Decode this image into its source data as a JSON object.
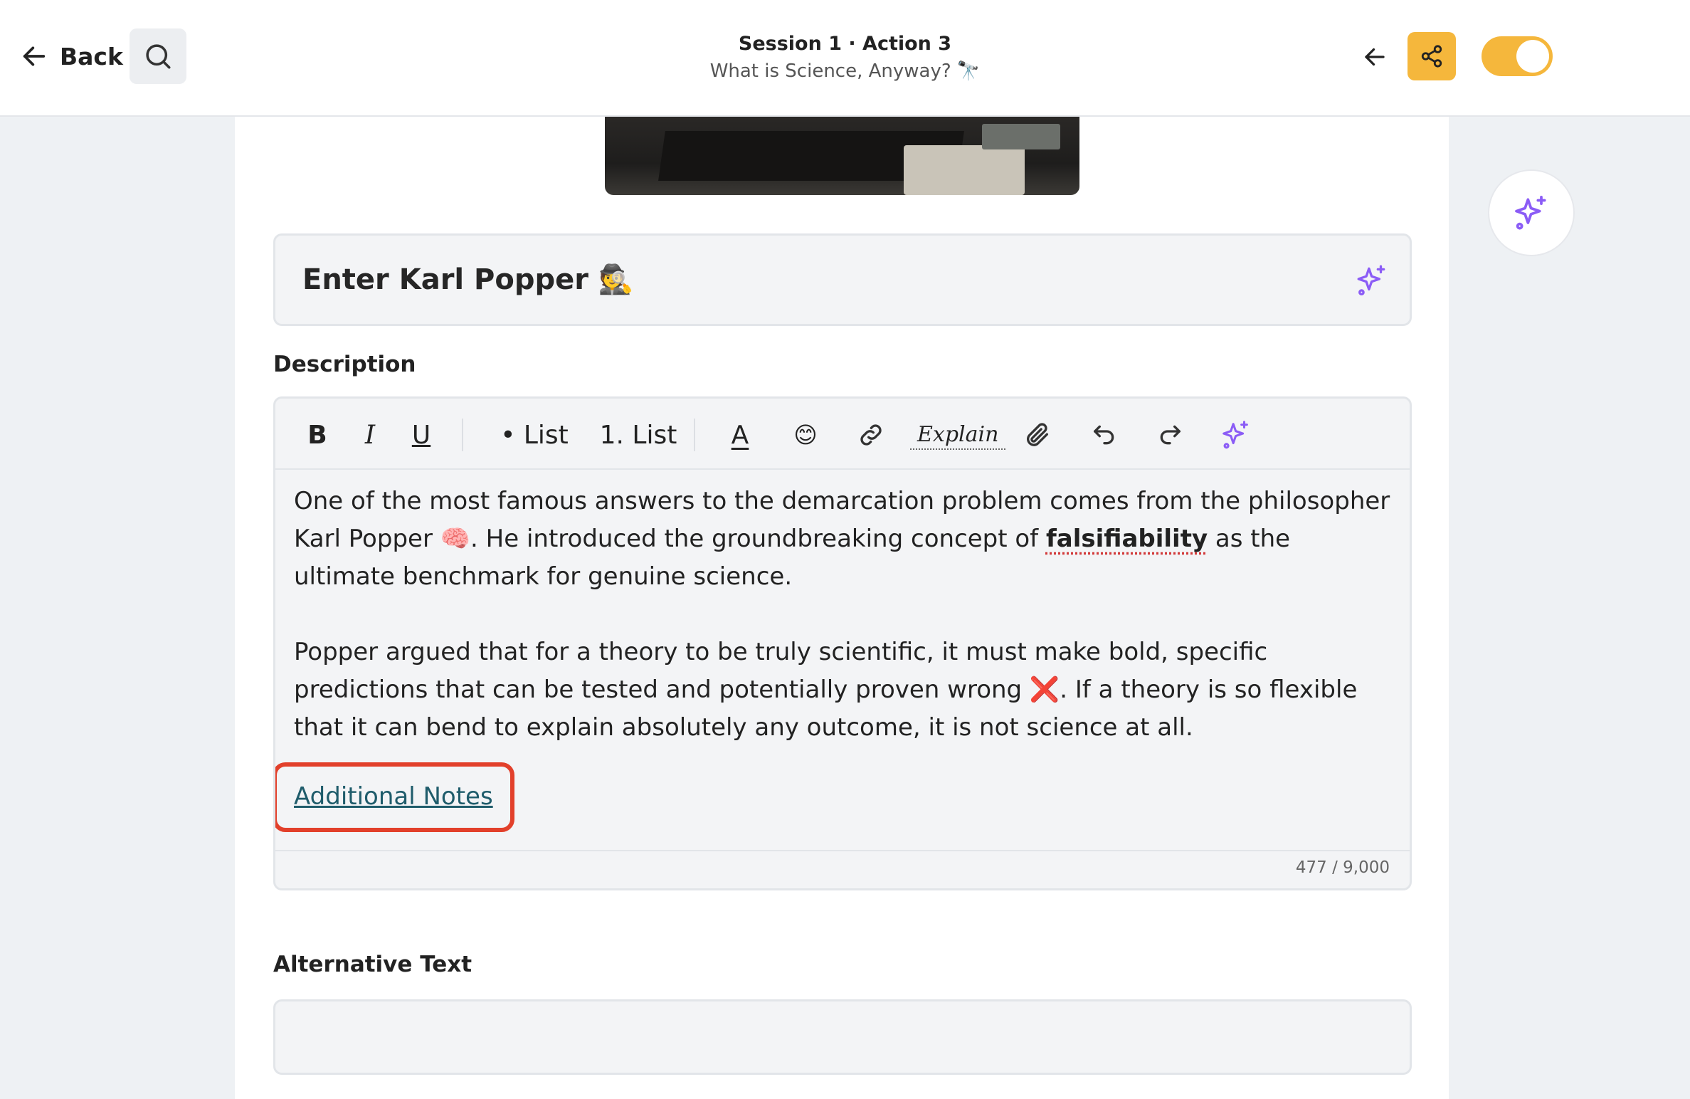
{
  "header": {
    "back_label": "Back",
    "title": "Session 1 · Action 3",
    "subtitle": "What is Science, Anyway? 🔭",
    "toggle_on": true
  },
  "title_field": {
    "value": "Enter Karl Popper 🕵️"
  },
  "description": {
    "label": "Description",
    "toolbar": {
      "bold": "B",
      "italic": "I",
      "underline": "U",
      "bullet_list": "• List",
      "numbered_list": "1. List",
      "text_color": "A",
      "emoji": "😊",
      "explain": "Explain"
    },
    "paragraph1_pre": "One of the most famous answers to the demarcation problem comes from the philosopher Karl Popper 🧠. He introduced the groundbreaking concept of ",
    "paragraph1_bold": "falsifiability",
    "paragraph1_post": " as the ultimate benchmark for genuine science.",
    "paragraph2": "Popper argued that for a theory to be truly scientific, it must make bold, specific predictions that can be tested and potentially proven wrong ❌. If a theory is so flexible that it can bend to explain absolutely any outcome, it is not science at all.",
    "link_text": "Additional Notes",
    "char_count": "477 / 9,000"
  },
  "alt_text": {
    "label": "Alternative Text",
    "value": ""
  },
  "colors": {
    "accent": "#f5b73c",
    "ai_purple": "#8b5cf6",
    "highlight": "#e2402b",
    "link": "#1f5c6b"
  },
  "icons": [
    "arrow-left-icon",
    "search-icon",
    "share-icon",
    "sparkles-icon",
    "link-icon",
    "paperclip-icon",
    "undo-icon",
    "redo-icon"
  ]
}
